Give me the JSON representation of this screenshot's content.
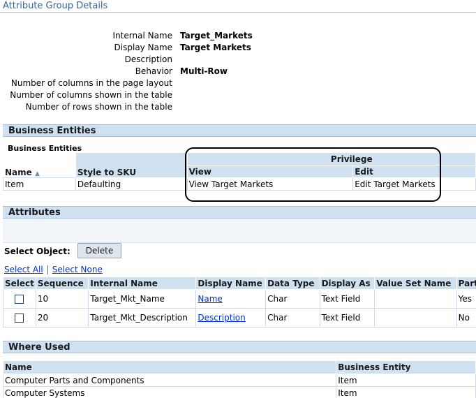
{
  "page_title": "Attribute Group Details",
  "details": [
    {
      "label": "Internal Name",
      "value": "Target_Markets"
    },
    {
      "label": "Display Name",
      "value": "Target Markets"
    },
    {
      "label": "Description",
      "value": ""
    },
    {
      "label": "Behavior",
      "value": "Multi-Row"
    },
    {
      "label": "Number of columns in the page layout",
      "value": ""
    },
    {
      "label": "Number of columns shown in the table",
      "value": ""
    },
    {
      "label": "Number of rows shown in the table",
      "value": ""
    }
  ],
  "business_entities": {
    "section_title": "Business Entities",
    "subtitle": "Business Entities",
    "group_header": "Privilege",
    "columns": [
      "Name",
      "Style to SKU",
      "View",
      "Edit"
    ],
    "sort_indicator": "▲",
    "rows": [
      [
        "Item",
        "Defaulting",
        "View Target Markets",
        "Edit Target Markets"
      ]
    ]
  },
  "attributes": {
    "section_title": "Attributes",
    "select_object_label": "Select Object:",
    "delete_label": "Delete",
    "select_all": "Select All",
    "select_none": "Select None",
    "columns": [
      "Select",
      "Sequence",
      "Internal Name",
      "Display Name",
      "Data Type",
      "Display As",
      "Value Set Name",
      "Part"
    ],
    "rows": [
      {
        "sequence": "10",
        "internal_name": "Target_Mkt_Name",
        "display_name": "Name",
        "data_type": "Char",
        "display_as": "Text Field",
        "value_set": "",
        "part": "Yes"
      },
      {
        "sequence": "20",
        "internal_name": "Target_Mkt_Description",
        "display_name": "Description",
        "data_type": "Char",
        "display_as": "Text Field",
        "value_set": "",
        "part": "No"
      }
    ]
  },
  "where_used": {
    "section_title": "Where Used",
    "columns": [
      "Name",
      "Business Entity"
    ],
    "rows": [
      [
        "Computer Parts and Components",
        "Item"
      ],
      [
        "Computer Systems",
        "Item"
      ]
    ]
  },
  "colors": {
    "header_band": "#cfe0f1",
    "title_text": "#336699",
    "link": "#0033cc"
  }
}
